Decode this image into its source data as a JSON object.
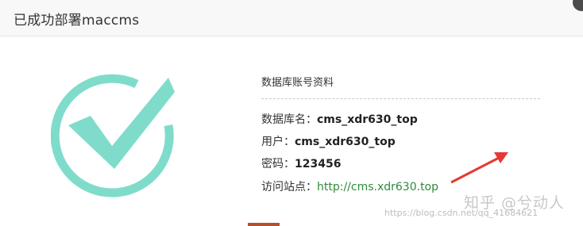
{
  "dialog": {
    "title": "已成功部署maccms",
    "close_icon": "close-icon"
  },
  "success_icon": "check-circle-icon",
  "colors": {
    "check": "#7fdccb",
    "link": "#2e8b3a",
    "arrow": "#e53935"
  },
  "info": {
    "heading": "数据库账号资料",
    "db_name_label": "数据库名：",
    "db_name_value": "cms_xdr630_top",
    "user_label": "用户：",
    "user_value": "cms_xdr630_top",
    "password_label": "密码：",
    "password_value": "123456",
    "site_label": "访问站点：",
    "site_url": "http://cms.xdr630.top"
  },
  "watermarks": {
    "zhihu": "知乎 @兮动人",
    "csdn": "https://blog.csdn.net/qq_41684621"
  }
}
